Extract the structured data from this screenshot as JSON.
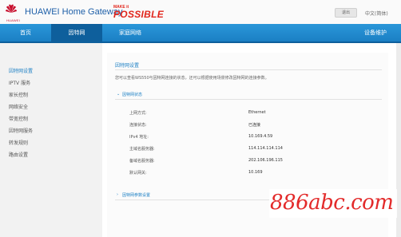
{
  "header": {
    "brand_logo": "huawei-logo",
    "brand_text": "HUAWEI",
    "product_title": "HUAWEI Home Gateway",
    "slogan_small": "MAKE it",
    "slogan_big": "POSSIBLE",
    "logout_label": "退出",
    "language": "中文(简体)"
  },
  "nav": {
    "items": [
      {
        "label": "首页"
      },
      {
        "label": "因特网"
      },
      {
        "label": "家庭网络"
      },
      {
        "label": "设备维护"
      }
    ],
    "active_index": 1,
    "bar_color": "#1b7fc4",
    "active_color": "#0e5f9c"
  },
  "sidebar": {
    "items": [
      {
        "label": "因特网设置"
      },
      {
        "label": "IPTV 服务"
      },
      {
        "label": "家长控制"
      },
      {
        "label": "网络安全"
      },
      {
        "label": "带宽控制"
      },
      {
        "label": "因特网服务"
      },
      {
        "label": "转发规则"
      },
      {
        "label": "路由设置"
      }
    ],
    "active_index": 0
  },
  "main": {
    "title": "因特网设置",
    "description": "您可以查看WS550与因特网连接的状态，还可以根据使用场景修改因特网的连接参数。",
    "status_section": {
      "title": "因特网状态",
      "expanded": true,
      "rows": [
        {
          "label": "上网方式:",
          "value": "Ethernet"
        },
        {
          "label": "连接状态:",
          "value": "已连接"
        },
        {
          "label": "IPv4 地址:",
          "value": "10.169.4.59"
        },
        {
          "label": "主域名服务器:",
          "value": "114.114.114.114"
        },
        {
          "label": "备域名服务器:",
          "value": "202.106.196.115"
        },
        {
          "label": "默认网关:",
          "value": "10.169"
        }
      ]
    },
    "settings_section": {
      "title": "因特网参数设置",
      "expanded": false
    }
  },
  "watermark": {
    "text": "886abc.com",
    "color": "#e32a2a"
  },
  "icons": {
    "expanded_chevron": "⌄",
    "collapsed_chevron": "›"
  }
}
